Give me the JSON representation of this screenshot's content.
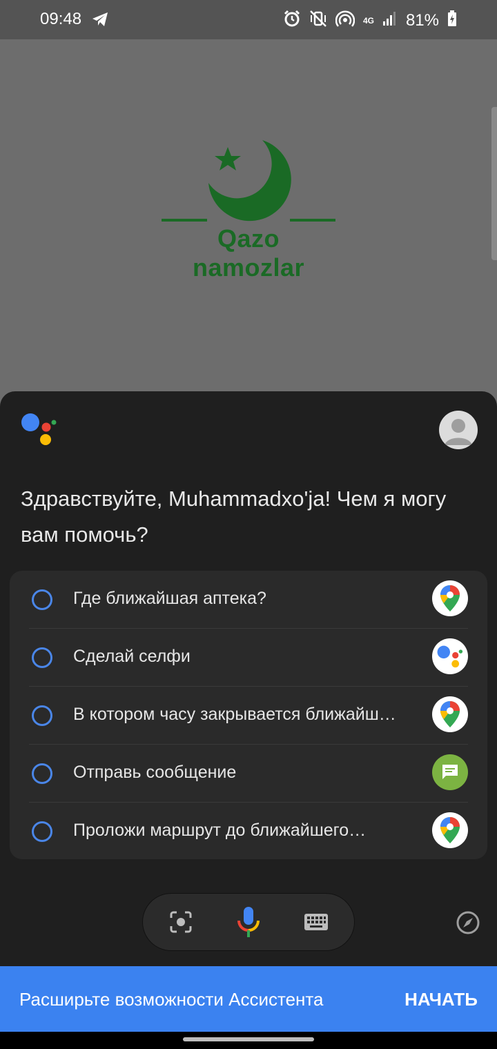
{
  "status_bar": {
    "time": "09:48",
    "network": "4G",
    "battery": "81%"
  },
  "app": {
    "logo_text": "Qazo namozlar"
  },
  "assistant": {
    "greeting": "Здравствуйте, Muhammadxo'ja! Чем я могу вам помочь?",
    "suggestions": [
      {
        "label": "Где ближайшая аптека?",
        "app_icon": "google-maps-icon"
      },
      {
        "label": "Сделай селфи",
        "app_icon": "google-assistant-icon"
      },
      {
        "label": "В котором часу закрывается ближайш…",
        "app_icon": "google-maps-icon"
      },
      {
        "label": "Отправь сообщение",
        "app_icon": "messages-icon"
      },
      {
        "label": "Проложи маршрут до ближайшего…",
        "app_icon": "google-maps-icon"
      }
    ]
  },
  "promo": {
    "text": "Расширьте возможности Ассистента",
    "button": "НАЧАТЬ"
  },
  "colors": {
    "accent_blue": "#3b82f0",
    "logo_green": "#1a6a25",
    "sheet_bg": "#1f1f1f"
  }
}
